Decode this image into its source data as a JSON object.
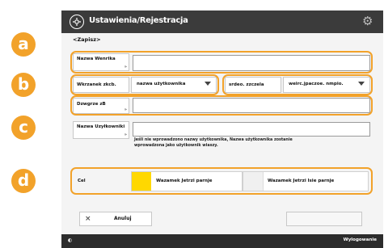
{
  "title_bar": {
    "title": "Ustawienia/Rejestracja"
  },
  "subheader": "<Zapisz>",
  "rows": {
    "user_name": {
      "label": "Nazwa Wenrika"
    },
    "login_method": {
      "label": "Wkrzanek zkcb.",
      "value": "nazwa użytkownika"
    },
    "domain": {
      "label": "srdeo. zzczela",
      "value": "weirc.jpaczoe. nmpio."
    },
    "password": {
      "label": "Dzwgrze zB"
    },
    "display_name": {
      "label": "Nazwa Uzyłkowniki"
    }
  },
  "note": "Jeśli nie wprowadzono nazwy użytkownika, Nazwa użytkownika zostanie wprowadzona jako użytkownik wiaszy.",
  "color": {
    "label": "Cel",
    "options": [
      {
        "label": "Wazamek Jetrzi parnje",
        "swatch": "#ffd800"
      },
      {
        "label": "Wazamek Jetrzi lsie parnje",
        "swatch": "#f0f0f0"
      }
    ]
  },
  "buttons": {
    "cancel": "Anuluj"
  },
  "footer": {
    "left": "◐",
    "right": "Wylogowanie"
  },
  "badges": [
    "a",
    "b",
    "c",
    "d"
  ],
  "colors": {
    "accent": "#f2a22a",
    "titlebar": "#3b3b3b"
  }
}
